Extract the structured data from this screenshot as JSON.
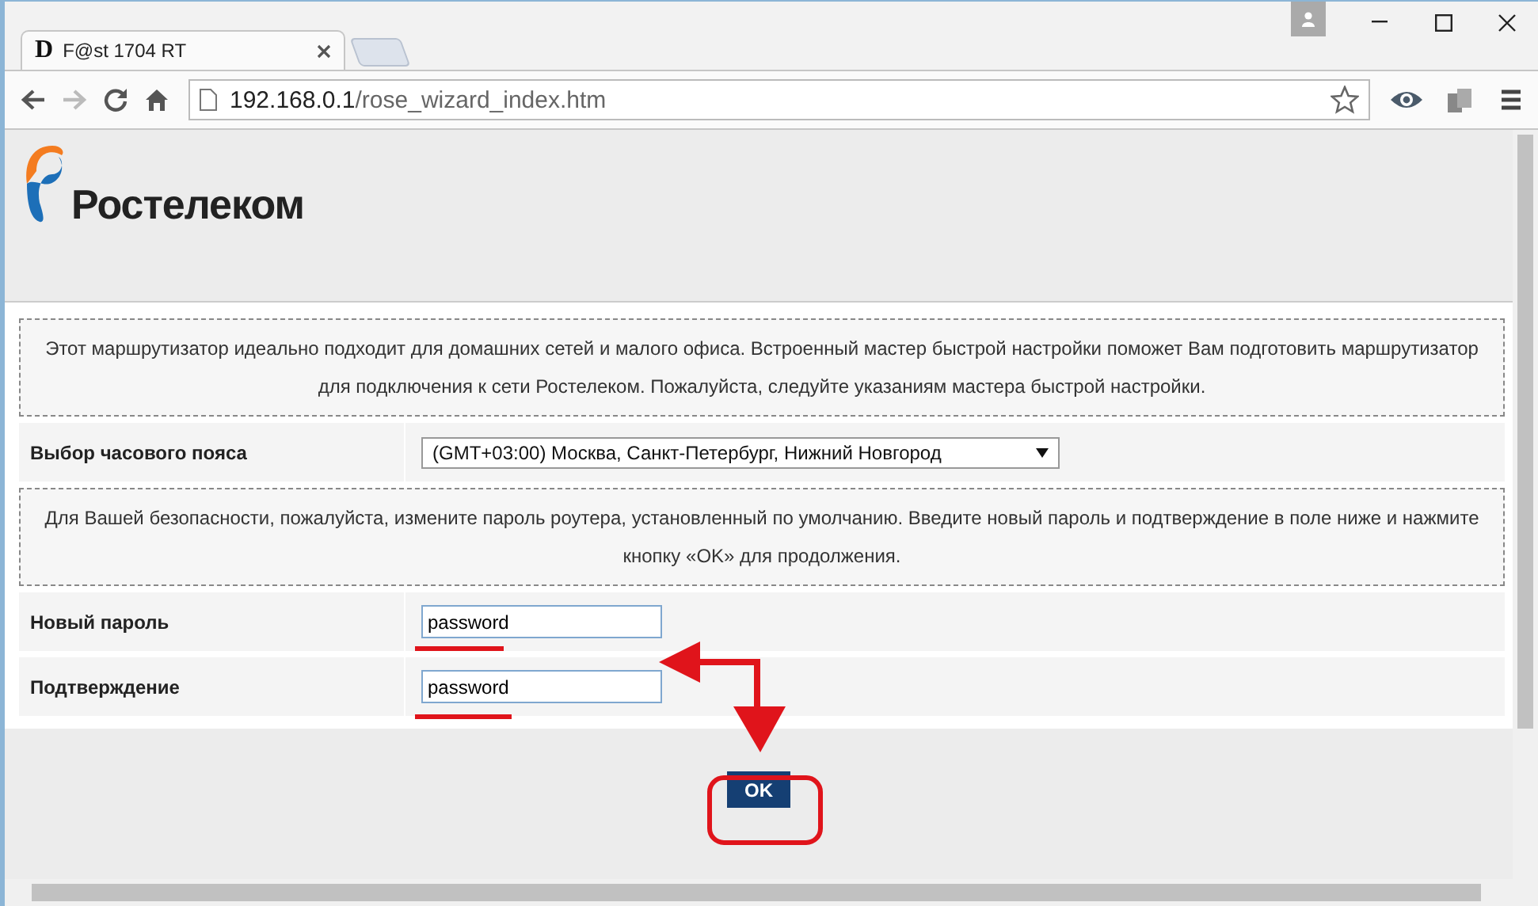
{
  "browser": {
    "tab": {
      "favicon": "D",
      "title": "F@st 1704 RT"
    },
    "address": {
      "host": "192.168.0.1",
      "path": "/rose_wizard_index.htm"
    }
  },
  "page": {
    "logo": {
      "text": "Ростелеком"
    },
    "intro": "Этот маршрутизатор идеально подходит для домашних сетей и малого офиса. Встроенный мастер быстрой настройки поможет Вам подготовить маршрутизатор для подключения к сети Ростелеком. Пожалуйста, следуйте указаниям мастера быстрой настройки.",
    "timezone": {
      "label": "Выбор часового пояса",
      "value": "(GMT+03:00) Москва, Санкт-Петербург, Нижний Новгород"
    },
    "notice": "Для Вашей безопасности, пожалуйста, измените пароль роутера, установленный по умолчанию. Введите новый пароль и подтверждение в поле ниже и нажмите кнопку «OK» для продолжения.",
    "fields": [
      {
        "label": "Новый пароль",
        "value": "password"
      },
      {
        "label": "Подтверждение",
        "value": "password"
      }
    ],
    "ok_button": "OK"
  }
}
